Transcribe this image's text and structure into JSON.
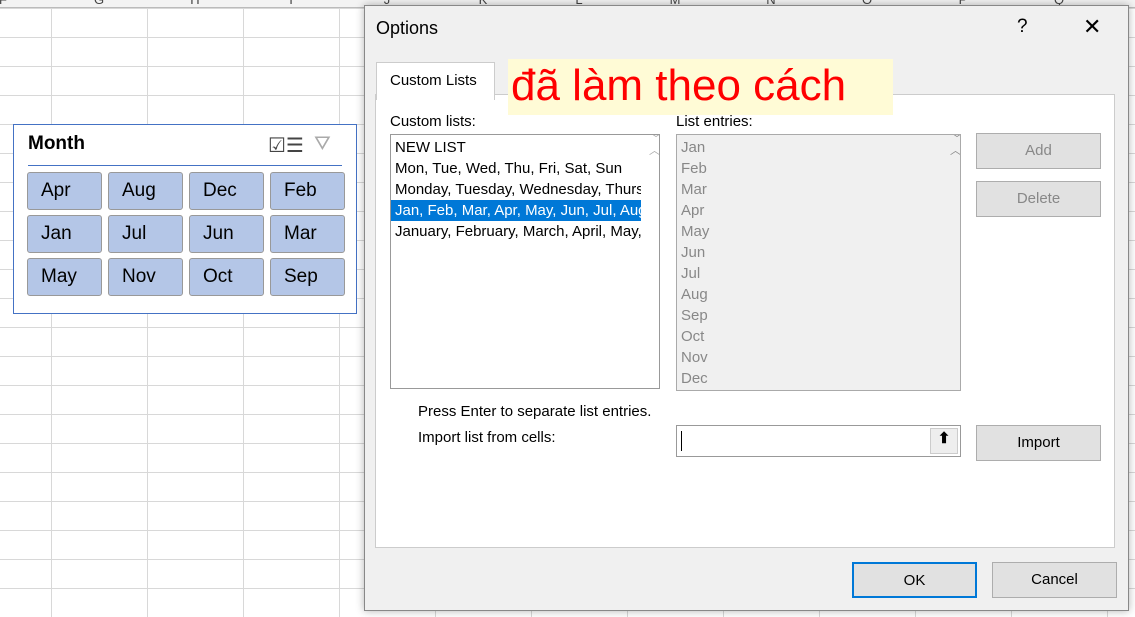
{
  "sheet": {
    "columns": [
      "F",
      "G",
      "H",
      "I",
      "J",
      "K",
      "L",
      "M",
      "N",
      "O",
      "P",
      "Q"
    ]
  },
  "slicer": {
    "title": "Month",
    "items": [
      "Apr",
      "Aug",
      "Dec",
      "Feb",
      "Jan",
      "Jul",
      "Jun",
      "Mar",
      "May",
      "Nov",
      "Oct",
      "Sep"
    ],
    "multi_select_icon": "multi-select-icon",
    "clear_filter_icon": "clear-filter-icon"
  },
  "dialog": {
    "title": "Options",
    "help": "?",
    "close": "✕",
    "tab": "Custom Lists",
    "annotation": "đã làm theo cách",
    "custom_lists_label": "Custom lists:",
    "list_entries_label": "List entries:",
    "custom_lists": [
      "NEW LIST",
      "Mon, Tue, Wed, Thu, Fri, Sat, Sun",
      "Monday, Tuesday, Wednesday, Thursday, Friday, Saturday, Sunday",
      "Jan, Feb, Mar, Apr, May, Jun, Jul, Aug, Sep, Oct, Nov, Dec",
      "January, February, March, April, May, June, July, August, September, October, November, December"
    ],
    "selected_index": 3,
    "entries": [
      "Jan",
      "Feb",
      "Mar",
      "Apr",
      "May",
      "Jun",
      "Jul",
      "Aug",
      "Sep",
      "Oct",
      "Nov",
      "Dec"
    ],
    "add": "Add",
    "delete": "Delete",
    "hint": "Press Enter to separate list entries.",
    "import_label": "Import list from cells:",
    "import_value": "",
    "import": "Import",
    "ok": "OK",
    "cancel": "Cancel"
  }
}
